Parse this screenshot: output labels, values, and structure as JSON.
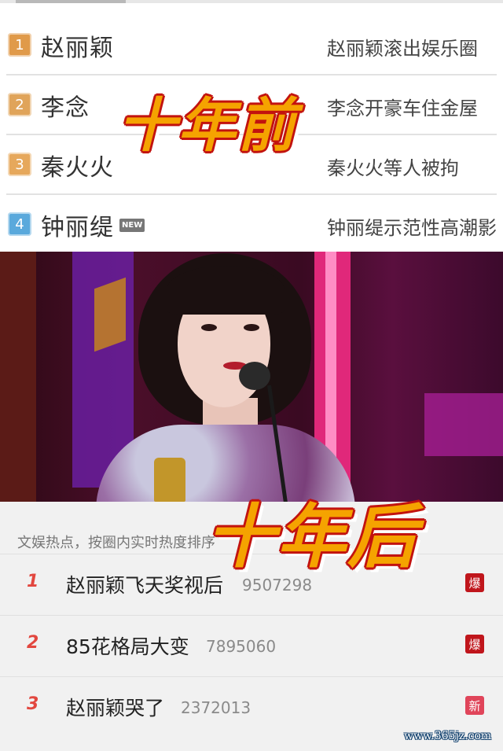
{
  "old_ranking": {
    "items": [
      {
        "rank": "1",
        "name": "赵丽颖",
        "topic": "赵丽颖滚出娱乐圈",
        "rank_color": "#e09a4a",
        "new": ""
      },
      {
        "rank": "2",
        "name": "李念",
        "topic": "李念开豪车住金屋",
        "rank_color": "#e0a45a",
        "new": ""
      },
      {
        "rank": "3",
        "name": "秦火火",
        "topic": "秦火火等人被拘",
        "rank_color": "#e6a85c",
        "new": ""
      },
      {
        "rank": "4",
        "name": "钟丽缇",
        "topic": "钟丽缇示范性高潮影",
        "rank_color": "#5aa9dc",
        "new": "NEW"
      }
    ]
  },
  "captions": {
    "before": "十年前",
    "after": "十年后"
  },
  "hot_list": {
    "header": "文娱热点，按圈内实时热度排序",
    "items": [
      {
        "rank": "1",
        "title": "赵丽颖飞天奖视后",
        "count": "9507298",
        "badge": "爆",
        "badge_color": "#c0161c"
      },
      {
        "rank": "2",
        "title": "85花格局大变",
        "count": "7895060",
        "badge": "爆",
        "badge_color": "#c0161c"
      },
      {
        "rank": "3",
        "title": "赵丽颖哭了",
        "count": "2372013",
        "badge": "新",
        "badge_color": "#e0455a"
      }
    ]
  },
  "watermark": "www.365jz.com"
}
